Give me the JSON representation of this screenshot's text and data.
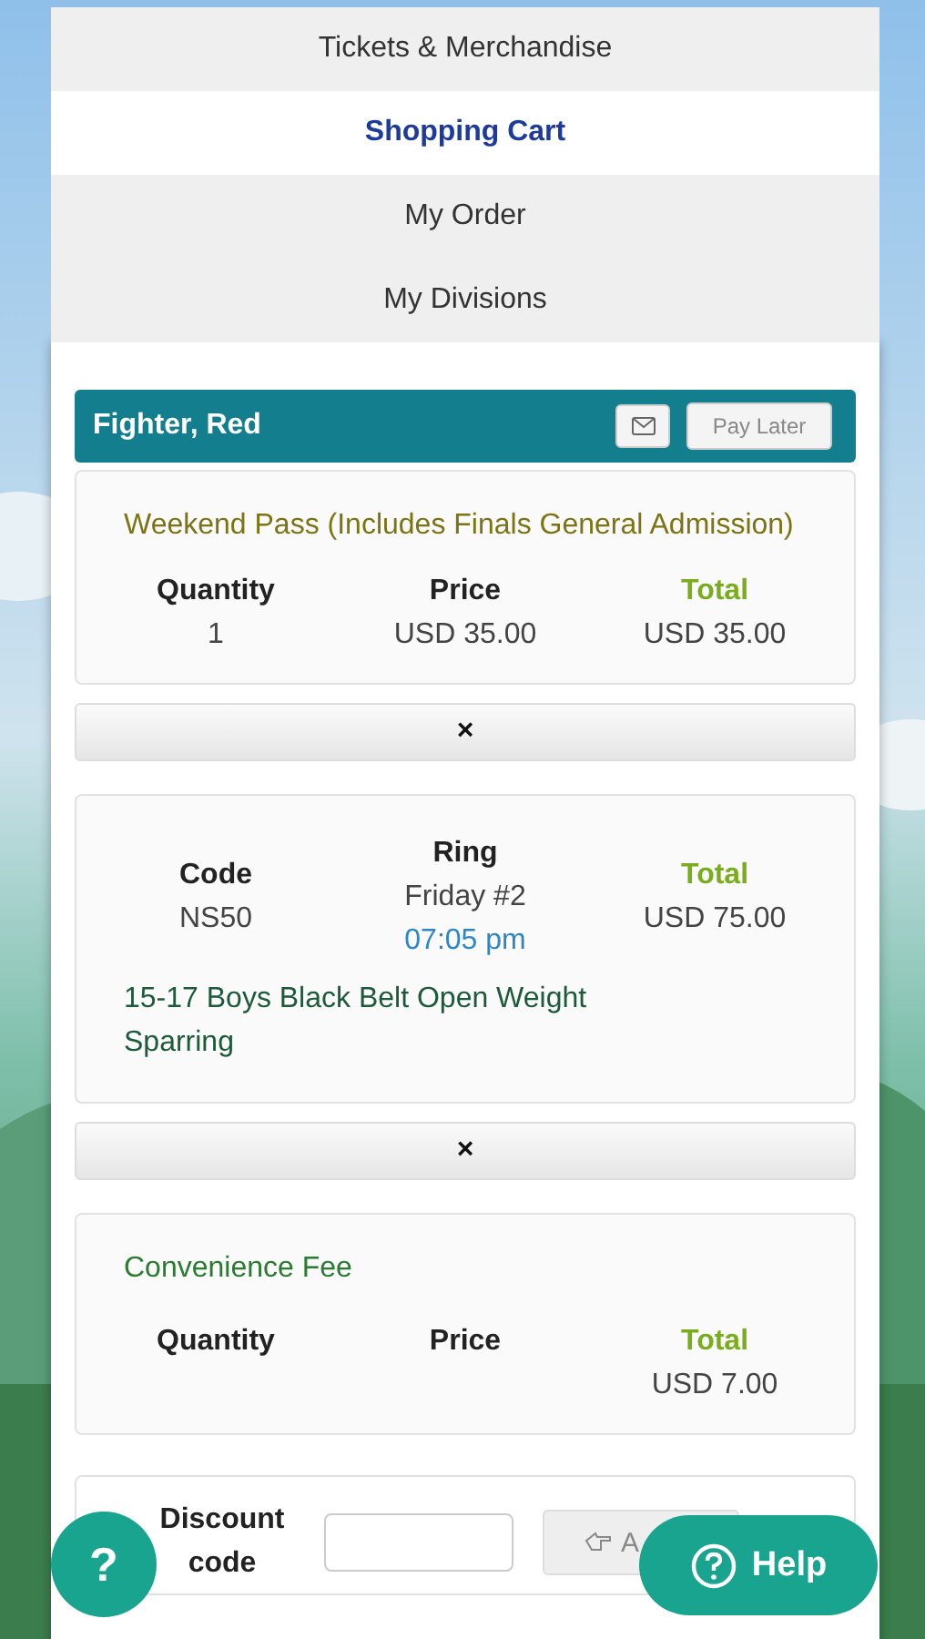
{
  "nav": [
    {
      "label": "Tickets & Merchandise",
      "selected": false
    },
    {
      "label": "Shopping Cart",
      "selected": true
    },
    {
      "label": "My Order",
      "selected": false
    },
    {
      "label": "My Divisions",
      "selected": false
    }
  ],
  "cart": {
    "name": "Fighter, Red",
    "pay_later": "Pay Later",
    "items": [
      {
        "kind": "product",
        "title": "Weekend Pass (Includes Finals General Admission)",
        "quantity_label": "Quantity",
        "quantity": "1",
        "price_label": "Price",
        "price": "USD 35.00",
        "total_label": "Total",
        "total": "USD 35.00",
        "remove": "×"
      },
      {
        "kind": "division",
        "code_label": "Code",
        "code": "NS50",
        "ring_label": "Ring",
        "ring": "Friday #2",
        "time": "07:05 pm",
        "total_label": "Total",
        "total": "USD 75.00",
        "title": "15-17 Boys Black Belt Open Weight Sparring",
        "remove": "×"
      },
      {
        "kind": "fee",
        "title": "Convenience Fee",
        "quantity_label": "Quantity",
        "price_label": "Price",
        "total_label": "Total",
        "total": "USD 7.00"
      }
    ],
    "discount": {
      "label": "Discount code",
      "apply": "A"
    }
  },
  "help_round": "?",
  "help_button": "Help"
}
